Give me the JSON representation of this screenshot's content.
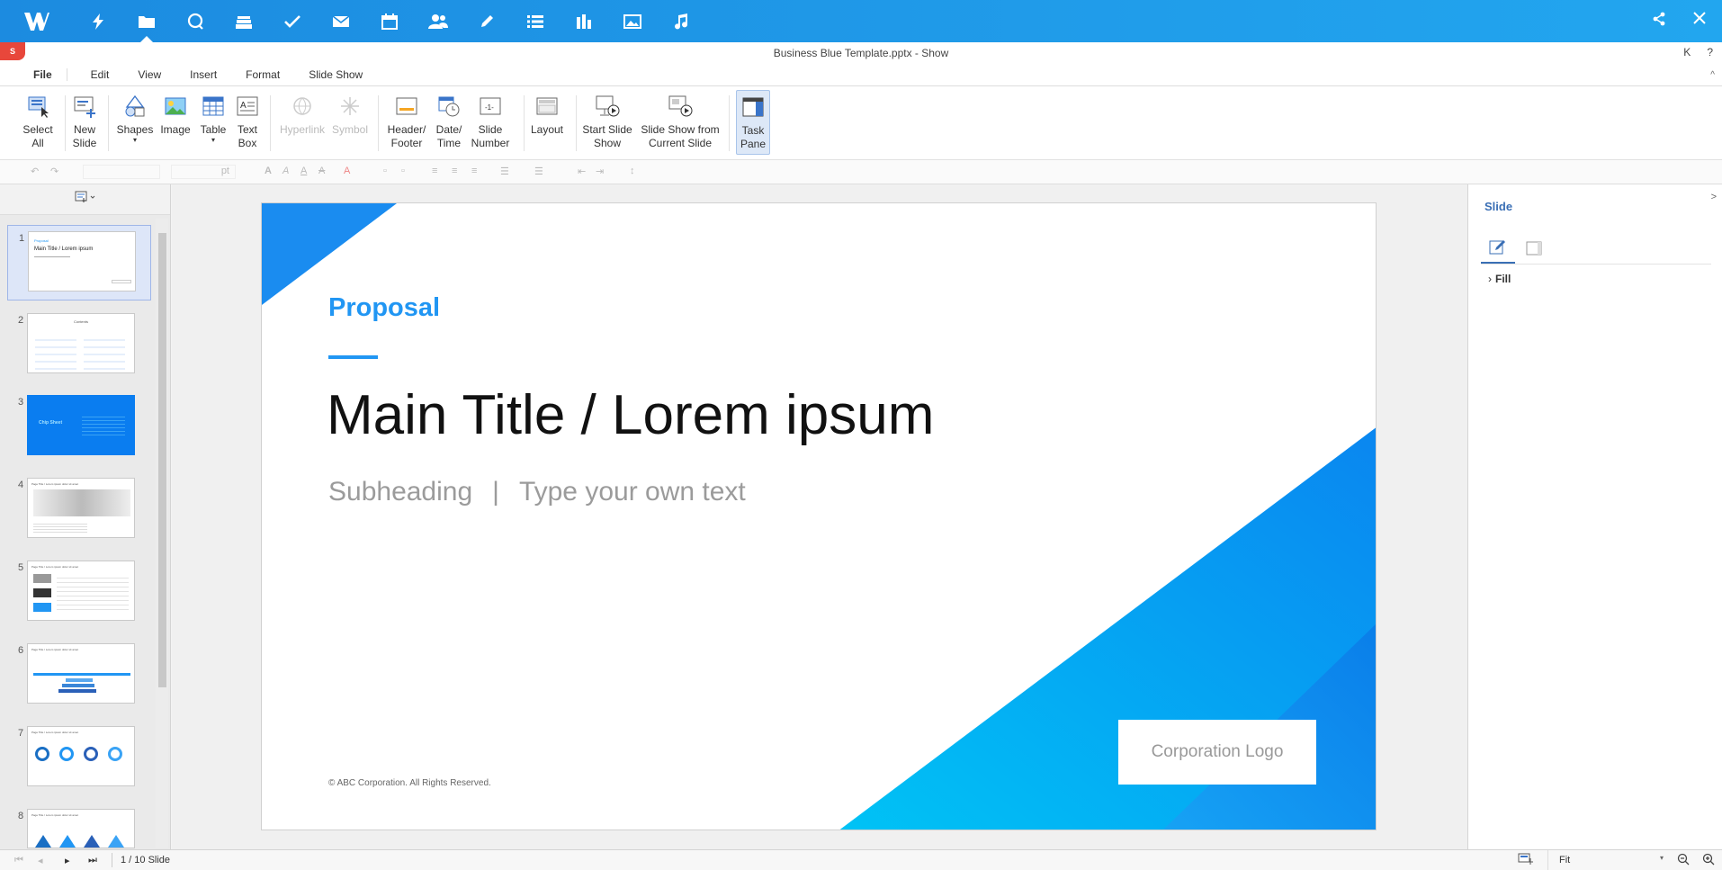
{
  "appbar": {
    "apps": [
      {
        "name": "lightning-icon"
      },
      {
        "name": "folder-icon",
        "active": true
      },
      {
        "name": "chat-bubble-icon"
      },
      {
        "name": "stack-icon"
      },
      {
        "name": "checkmark-icon"
      },
      {
        "name": "mail-icon"
      },
      {
        "name": "calendar-icon"
      },
      {
        "name": "contacts-icon"
      },
      {
        "name": "pencil-icon"
      },
      {
        "name": "list-icon"
      },
      {
        "name": "bar-chart-icon"
      },
      {
        "name": "image-icon"
      },
      {
        "name": "music-note-icon"
      }
    ]
  },
  "window": {
    "title": "Business Blue Template.pptx - Show",
    "badge": "S",
    "right_k": "K",
    "right_help": "?"
  },
  "menu": {
    "items": [
      "File",
      "Edit",
      "View",
      "Insert",
      "Format",
      "Slide Show"
    ],
    "collapse": "^"
  },
  "ribbon": {
    "select_all": "Select\nAll",
    "new_slide": "New\nSlide",
    "shapes": "Shapes",
    "image": "Image",
    "table": "Table",
    "text_box": "Text\nBox",
    "hyperlink": "Hyperlink",
    "symbol": "Symbol",
    "header_footer": "Header/\nFooter",
    "date_time": "Date/\nTime",
    "slide_number": "Slide\nNumber",
    "layout": "Layout",
    "start_slide_show": "Start Slide\nShow",
    "slide_show_from_current": "Slide Show from\nCurrent Slide",
    "task_pane": "Task\nPane",
    "dropdown_caret": "▾",
    "slide_number_icon_text": "-1-"
  },
  "format_bar": {
    "font_size_unit": "pt"
  },
  "thumbnails": [
    {
      "num": "1",
      "selected": true
    },
    {
      "num": "2"
    },
    {
      "num": "3"
    },
    {
      "num": "4"
    },
    {
      "num": "5"
    },
    {
      "num": "6"
    },
    {
      "num": "7"
    },
    {
      "num": "8"
    }
  ],
  "thumbnail_text": {
    "t1_kicker": "Proposal",
    "t1_title": "Main Title / Lorem ipsum",
    "t2_title": "Contents",
    "t3_title": "Chip Sheet",
    "t4_title": "Page Title / Lorem ipsum dolor sit amet"
  },
  "slide": {
    "kicker": "Proposal",
    "main_title": "Main Title / Lorem ipsum",
    "subheading": "Subheading",
    "divider": "|",
    "subtext": "Type your own text",
    "copyright": "© ABC Corporation. All Rights Reserved.",
    "logo_box": "Corporation Logo"
  },
  "task_pane": {
    "title": "Slide",
    "expand": ">",
    "fill_label": "Fill"
  },
  "status": {
    "page_indicator": "1 / 10 Slide",
    "zoom_mode": "Fit"
  },
  "colors": {
    "appbar": "#1c8be0",
    "accent": "#2196f3",
    "slide_blue": "#0a9af0"
  }
}
